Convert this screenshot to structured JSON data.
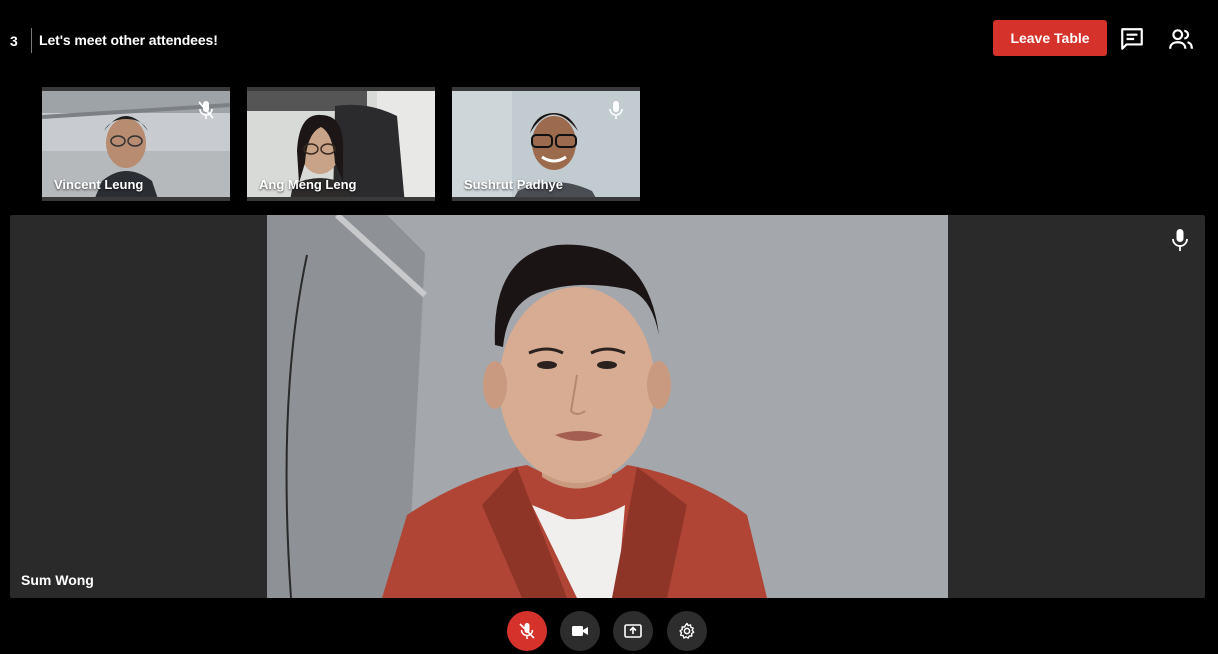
{
  "header": {
    "table_number": "3",
    "table_title": "Let's meet other attendees!",
    "leave_button_label": "Leave Table",
    "chat_icon": "chat-icon",
    "people_icon": "people-icon"
  },
  "participants": [
    {
      "name": "Vincent Leung",
      "mic_state": "muted",
      "mic_icon": "mic-off-icon"
    },
    {
      "name": "Ang Meng Leng",
      "mic_state": "none"
    },
    {
      "name": "Sushrut Padhye",
      "mic_state": "on",
      "mic_icon": "mic-icon"
    }
  ],
  "main_speaker": {
    "name": "Sum Wong",
    "mic_state": "on",
    "mic_icon": "mic-icon"
  },
  "controls": [
    {
      "name": "mute-mic",
      "icon": "mic-off-icon",
      "active": true
    },
    {
      "name": "camera",
      "icon": "video-camera-icon"
    },
    {
      "name": "share-screen",
      "icon": "screen-share-icon"
    },
    {
      "name": "settings",
      "icon": "gear-icon"
    }
  ],
  "colors": {
    "background": "#000000",
    "accent_red": "#d6322c",
    "stage_bg": "#2a2a2a",
    "control_bg": "#2d2d2d"
  }
}
